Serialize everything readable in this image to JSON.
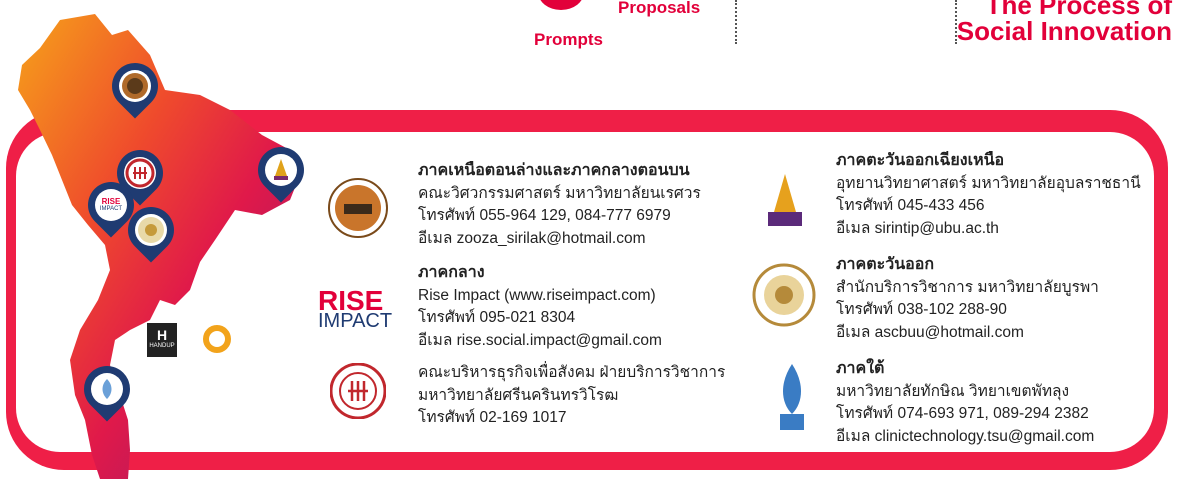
{
  "header": {
    "prompts": "Prompts",
    "proposals": "Proposals",
    "process_line1": "The Process of",
    "process_line2": "Social Innovation"
  },
  "logos": {
    "rise": "RISE",
    "impact": "IMPACT",
    "handup": "HANDUP"
  },
  "regions": [
    {
      "heading": "ภาคเหนือตอนล่างและภาคกลางตอนบน",
      "lines": [
        "คณะวิศวกรรมศาสตร์ มหาวิทยาลัยนเรศวร",
        "โทรศัพท์ 055-964 129, 084-777 6979",
        "อีเมล zooza_sirilak@hotmail.com"
      ]
    },
    {
      "heading": "ภาคกลาง",
      "lines": [
        "Rise Impact (www.riseimpact.com)",
        "โทรศัพท์ 095-021 8304",
        "อีเมล rise.social.impact@gmail.com"
      ]
    },
    {
      "heading": "",
      "lines": [
        "คณะบริหารธุรกิจเพื่อสังคม ฝ่ายบริการวิชาการ",
        "มหาวิทยาลัยศรีนครินทรวิโรฒ",
        "โทรศัพท์ 02-169 1017"
      ]
    },
    {
      "heading": "ภาคตะวันออกเฉียงเหนือ",
      "lines": [
        "อุทยานวิทยาศาสตร์ มหาวิทยาลัยอุบลราชธานี",
        "โทรศัพท์ 045-433 456",
        "อีเมล sirintip@ubu.ac.th"
      ]
    },
    {
      "heading": "ภาคตะวันออก",
      "lines": [
        "สำนักบริการวิชาการ มหาวิทยาลัยบูรพา",
        "โทรศัพท์ 038-102 288-90",
        "อีเมล ascbuu@hotmail.com"
      ]
    },
    {
      "heading": "ภาคใต้",
      "lines": [
        "มหาวิทยาลัยทักษิณ วิทยาเขตพัทลุง",
        "โทรศัพท์ 074-693 971, 089-294 2382",
        "อีเมล clinictechnology.tsu@gmail.com"
      ]
    }
  ],
  "colors": {
    "accent": "#e2003a",
    "panel": "#ef1f47",
    "pin": "#1f3b72"
  }
}
